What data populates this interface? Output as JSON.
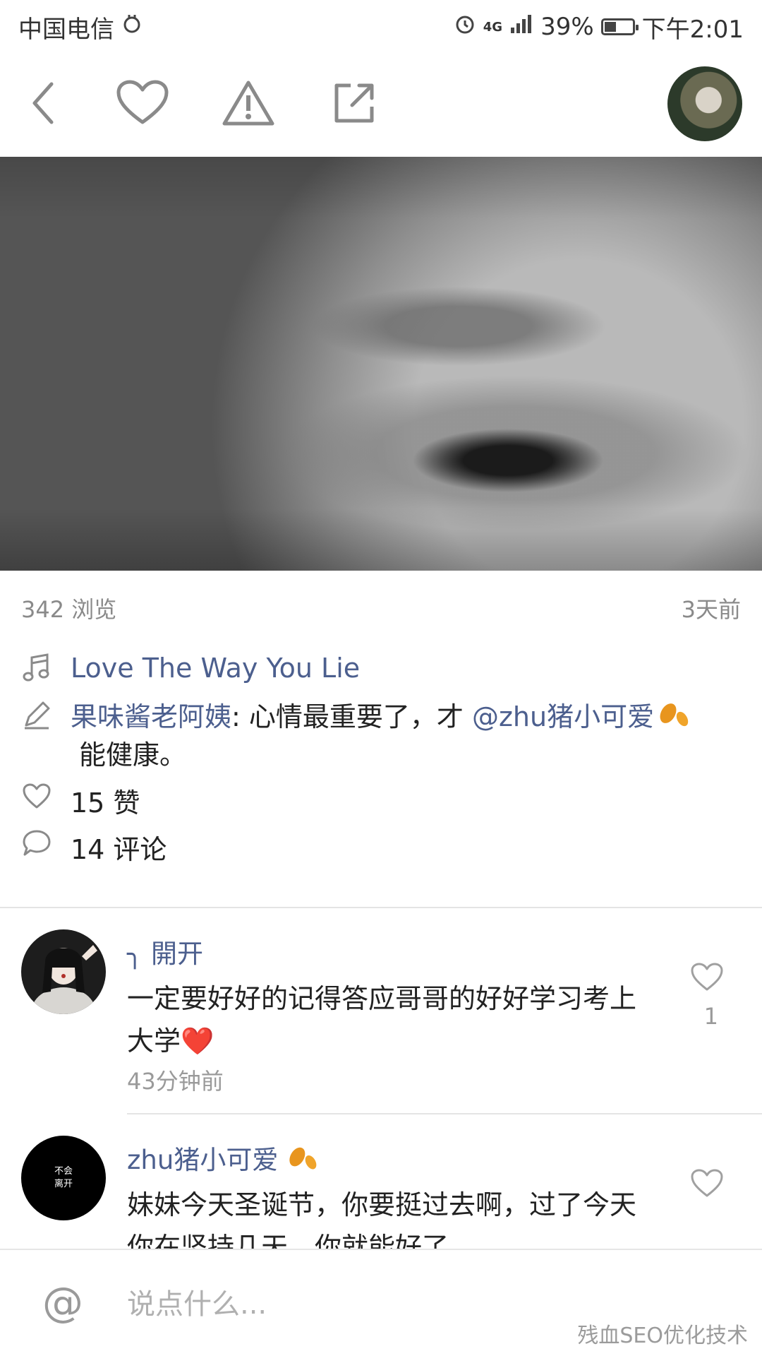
{
  "status_bar": {
    "carrier": "中国电信",
    "network": "4G",
    "battery": "39%",
    "time": "下午2:01"
  },
  "post": {
    "views": "342 浏览",
    "posted": "3天前",
    "song": "Love The Way You Lie",
    "author": "果味酱老阿姨",
    "caption_pre": ": 心情最重要了，才 ",
    "mention": "@zhu猪小可爱",
    "caption_post": "能健康。",
    "likes": "15 赞",
    "comments": "14 评论"
  },
  "comments": [
    {
      "user": "╮ 開开",
      "text": "一定要好好的记得答应哥哥的好好学习考上大学❤️",
      "time": "43分钟前",
      "likes": "1"
    },
    {
      "user": "zhu猪小可爱",
      "text": "妹妹今天圣诞节，你要挺过去啊，过了今天你在坚持几天，你就能好了",
      "avatar_text": "不会离开"
    }
  ],
  "reply": {
    "placeholder": "说点什么..."
  },
  "watermark": "残血SEO优化技术"
}
